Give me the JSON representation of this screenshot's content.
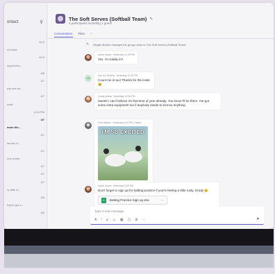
{
  "sidebar": {
    "title": "ontact",
    "filter_icon": "filter-icon",
    "items": [
      {
        "name": "",
        "time": "4/13",
        "bold": false
      },
      {
        "name": "st board",
        "time": "",
        "bold": false
      },
      {
        "name": "",
        "time": "4/13",
        "bold": false
      },
      {
        "name": "ing produc...",
        "time": "",
        "bold": false
      },
      {
        "name": "",
        "time": "4/8",
        "bold": false
      },
      {
        "name": "",
        "time": "4/7",
        "bold": false
      },
      {
        "name": "nily nite bo...",
        "time": "",
        "bold": false
      },
      {
        "name": "",
        "time": "4/7",
        "bold": false
      },
      {
        "name": "nust!",
        "time": "",
        "bold": false
      },
      {
        "name": "",
        "time": "6:16 PM",
        "bold": false
      },
      {
        "name": "",
        "time": "4/7",
        "bold": true
      },
      {
        "name": "team thh...",
        "time": "",
        "bold": true
      },
      {
        "name": "",
        "time": "4/7",
        "bold": false
      },
      {
        "name": "ket like tt...",
        "time": "",
        "bold": false
      },
      {
        "name": "",
        "time": "4/7",
        "bold": false
      },
      {
        "name": "ony celebr...",
        "time": "",
        "bold": false
      },
      {
        "name": "",
        "time": "4/7",
        "bold": false
      },
      {
        "name": "",
        "time": "4/7",
        "bold": false
      },
      {
        "name": "",
        "time": "4/7",
        "bold": false
      },
      {
        "name": "ry date is...",
        "time": "",
        "bold": false
      },
      {
        "name": "",
        "time": "4/6",
        "bold": false
      },
      {
        "name": "hey're got s...",
        "time": "",
        "bold": false
      },
      {
        "name": "",
        "time": "4/6",
        "bold": false
      }
    ]
  },
  "header": {
    "team_name": "The Soft Serves (Softball Team)",
    "subtitle": "4 participants including 1 guest",
    "tabs": [
      {
        "label": "Conversation",
        "active": true
      },
      {
        "label": "Files",
        "active": false
      }
    ],
    "add_tab": "+"
  },
  "system_message": "Megan Bowen changed the group name to The Soft Serves (Softball Team).",
  "messages": [
    {
      "author": "Adele Vance",
      "time": "Yesterday 12:35 PM",
      "text": "Yes. I'm totally in!!",
      "avatar": "photo1"
    },
    {
      "author": "Lee Gu (Guest)",
      "time": "Yesterday 12:43 PM",
      "text": "Count me in too! Thanks for the invite 😀",
      "avatar": "initials",
      "initials": "LG"
    },
    {
      "author": "Grady Archie",
      "time": "Yesterday 12:53 PM",
      "text": "Sweet! I can't believe it's that time of year already. You know I'll be there. I've got some extra equipment too if anybody needs to borrow anything.",
      "avatar": "photo2"
    },
    {
      "author": "Pete Walker",
      "time": "Yesterday 3:44 PM",
      "edited": "Edited",
      "gif_caption": "I'M SO EXCITED",
      "avatar": "photo3"
    },
    {
      "author": "Adele Vance",
      "time": "Yesterday 3:39 PM",
      "text": "Don't forget to sign up for batting practice if you're feeling a little rusty, Grady 😉",
      "attachment": "Batting Practice Sign up.xlsx",
      "attachment_more": "···",
      "avatar": "photo4"
    }
  ],
  "composer": {
    "placeholder": "Type a new message",
    "tools": [
      "A",
      "!",
      "⌀",
      "☺",
      "▦",
      "▢",
      "⊞",
      "···"
    ],
    "send": "➤"
  }
}
